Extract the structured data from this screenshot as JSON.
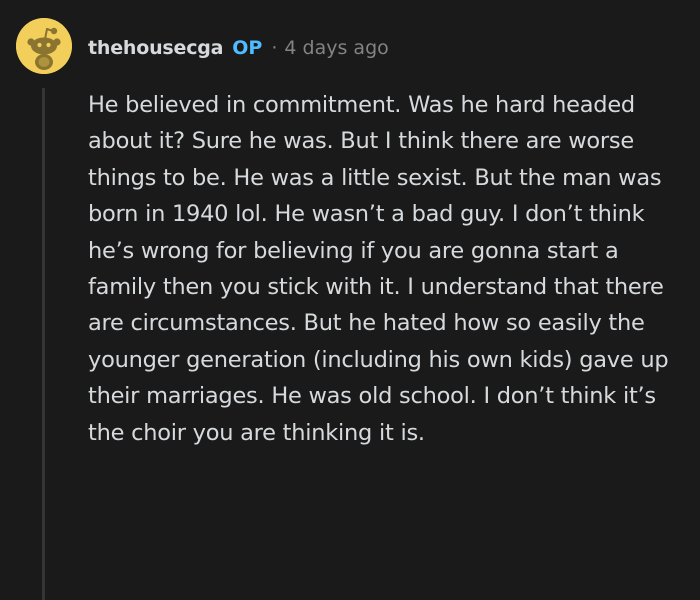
{
  "comment": {
    "username": "thehousecga",
    "op_badge": "OP",
    "separator": "·",
    "timestamp": "4 days ago",
    "body": "He believed in commitment. Was he hard headed about it? Sure he was. But I think there are worse things to be. He was a little sexist. But the man was born in 1940 lol. He wasn’t a bad guy. I don’t think he’s wrong for believing if you are gonna start a family then you stick with it. I understand that there are circumstances. But he hated how so easily the younger generation (including his own kids) gave up their marriages. He was old school. I don’t think it’s the choir you are thinking it is."
  },
  "avatar": {
    "icon": "reddit-snoo-icon",
    "background_color": "#f2cf5b"
  },
  "colors": {
    "background": "#1a1a1b",
    "text": "#d7dadc",
    "muted": "#818384",
    "op_accent": "#4fbcff",
    "thread_line": "#343536"
  }
}
